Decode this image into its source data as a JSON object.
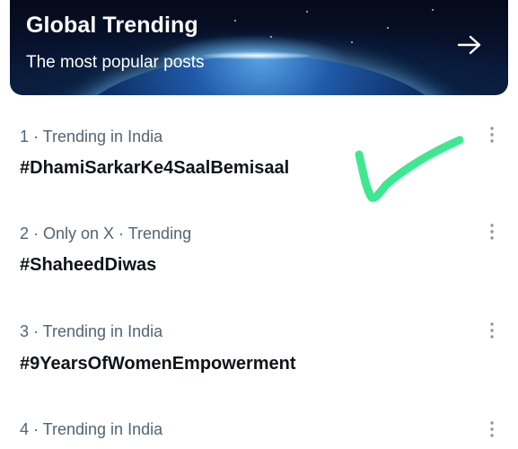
{
  "banner": {
    "title": "Global Trending",
    "subtitle": "The most popular posts",
    "arrow_icon": "arrow-right-icon"
  },
  "trends": [
    {
      "meta": "1 · Trending in India",
      "tag": "#DhamiSarkarKe4SaalBemisaal",
      "menu_icon": "more-vertical-icon"
    },
    {
      "meta": "2 · Only on X · Trending",
      "tag": "#ShaheedDiwas",
      "menu_icon": "more-vertical-icon"
    },
    {
      "meta": "3 · Trending in India",
      "tag": "#9YearsOfWomenEmpowerment",
      "menu_icon": "more-vertical-icon"
    },
    {
      "meta": "4 · Trending in India",
      "tag": "",
      "menu_icon": "more-vertical-icon"
    }
  ],
  "annotation": {
    "icon": "hand-drawn-checkmark-icon",
    "color": "#3ee890"
  },
  "colors": {
    "meta_text": "#536471",
    "tag_text": "#0f1419",
    "icon_gray": "#8b98a5"
  }
}
